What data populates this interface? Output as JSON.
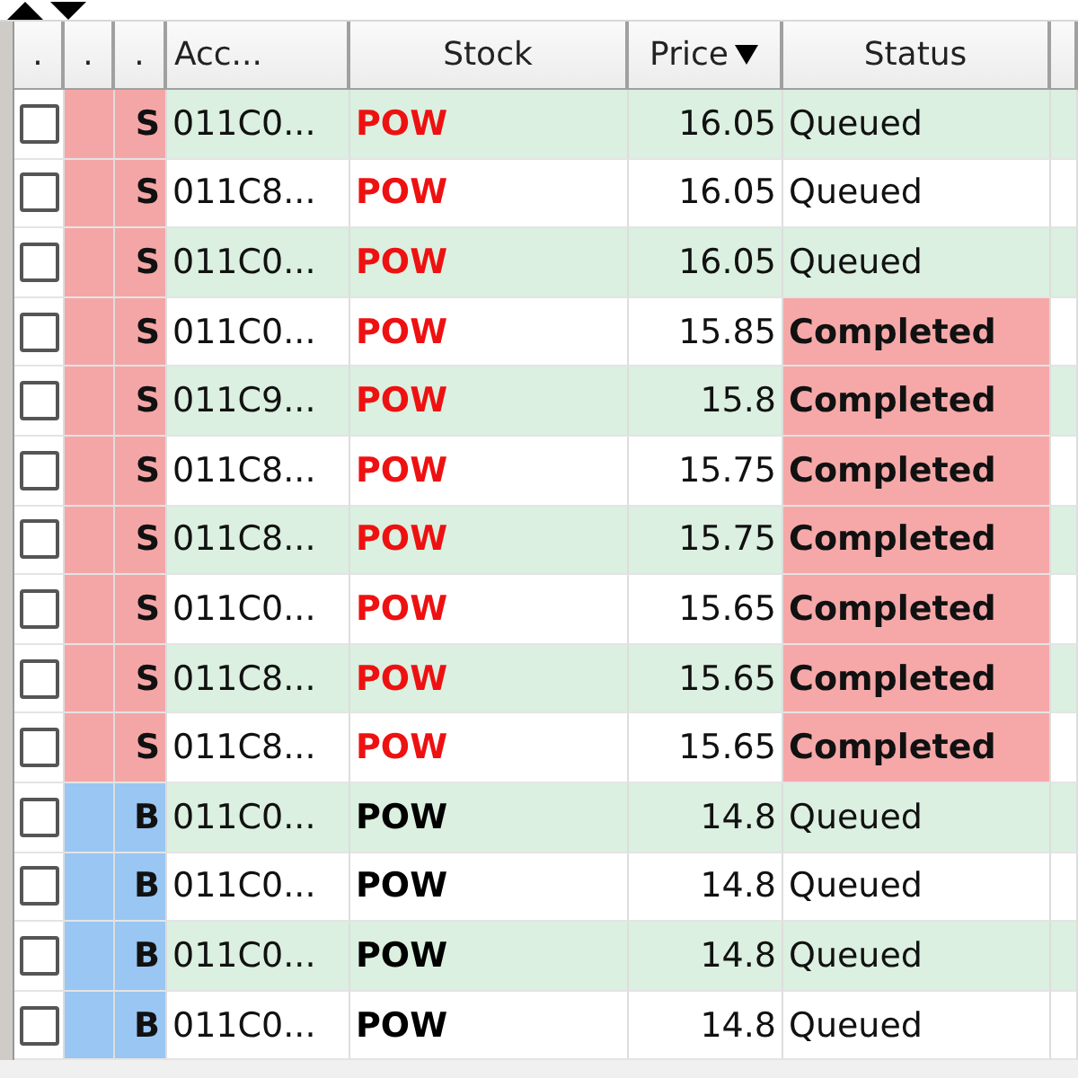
{
  "columns": [
    {
      "label": ".",
      "sorted": false
    },
    {
      "label": ".",
      "sorted": false
    },
    {
      "label": ".",
      "sorted": false
    },
    {
      "label": "Acc...",
      "sorted": false
    },
    {
      "label": "Stock",
      "sorted": false
    },
    {
      "label": "Price",
      "sorted": true
    },
    {
      "label": "Status",
      "sorted": false
    }
  ],
  "rows": [
    {
      "checked": false,
      "kind": "sell",
      "side": "S",
      "account": "011C0...",
      "stock": "POW",
      "price": "16.05",
      "status": "Queued",
      "status_highlighted": false
    },
    {
      "checked": false,
      "kind": "sell",
      "side": "S",
      "account": "011C8...",
      "stock": "POW",
      "price": "16.05",
      "status": "Queued",
      "status_highlighted": false
    },
    {
      "checked": false,
      "kind": "sell",
      "side": "S",
      "account": "011C0...",
      "stock": "POW",
      "price": "16.05",
      "status": "Queued",
      "status_highlighted": false
    },
    {
      "checked": false,
      "kind": "sell",
      "side": "S",
      "account": "011C0...",
      "stock": "POW",
      "price": "15.85",
      "status": "Completed",
      "status_highlighted": true
    },
    {
      "checked": false,
      "kind": "sell",
      "side": "S",
      "account": "011C9...",
      "stock": "POW",
      "price": "15.8",
      "status": "Completed",
      "status_highlighted": true
    },
    {
      "checked": false,
      "kind": "sell",
      "side": "S",
      "account": "011C8...",
      "stock": "POW",
      "price": "15.75",
      "status": "Completed",
      "status_highlighted": true
    },
    {
      "checked": false,
      "kind": "sell",
      "side": "S",
      "account": "011C8...",
      "stock": "POW",
      "price": "15.75",
      "status": "Completed",
      "status_highlighted": true
    },
    {
      "checked": false,
      "kind": "sell",
      "side": "S",
      "account": "011C0...",
      "stock": "POW",
      "price": "15.65",
      "status": "Completed",
      "status_highlighted": true
    },
    {
      "checked": false,
      "kind": "sell",
      "side": "S",
      "account": "011C8...",
      "stock": "POW",
      "price": "15.65",
      "status": "Completed",
      "status_highlighted": true
    },
    {
      "checked": false,
      "kind": "sell",
      "side": "S",
      "account": "011C8...",
      "stock": "POW",
      "price": "15.65",
      "status": "Completed",
      "status_highlighted": true
    },
    {
      "checked": false,
      "kind": "buy",
      "side": "B",
      "account": "011C0...",
      "stock": "POW",
      "price": "14.8",
      "status": "Queued",
      "status_highlighted": false
    },
    {
      "checked": false,
      "kind": "buy",
      "side": "B",
      "account": "011C0...",
      "stock": "POW",
      "price": "14.8",
      "status": "Queued",
      "status_highlighted": false
    },
    {
      "checked": false,
      "kind": "buy",
      "side": "B",
      "account": "011C0...",
      "stock": "POW",
      "price": "14.8",
      "status": "Queued",
      "status_highlighted": false
    },
    {
      "checked": false,
      "kind": "buy",
      "side": "B",
      "account": "011C0...",
      "stock": "POW",
      "price": "14.8",
      "status": "Queued",
      "status_highlighted": false
    }
  ]
}
